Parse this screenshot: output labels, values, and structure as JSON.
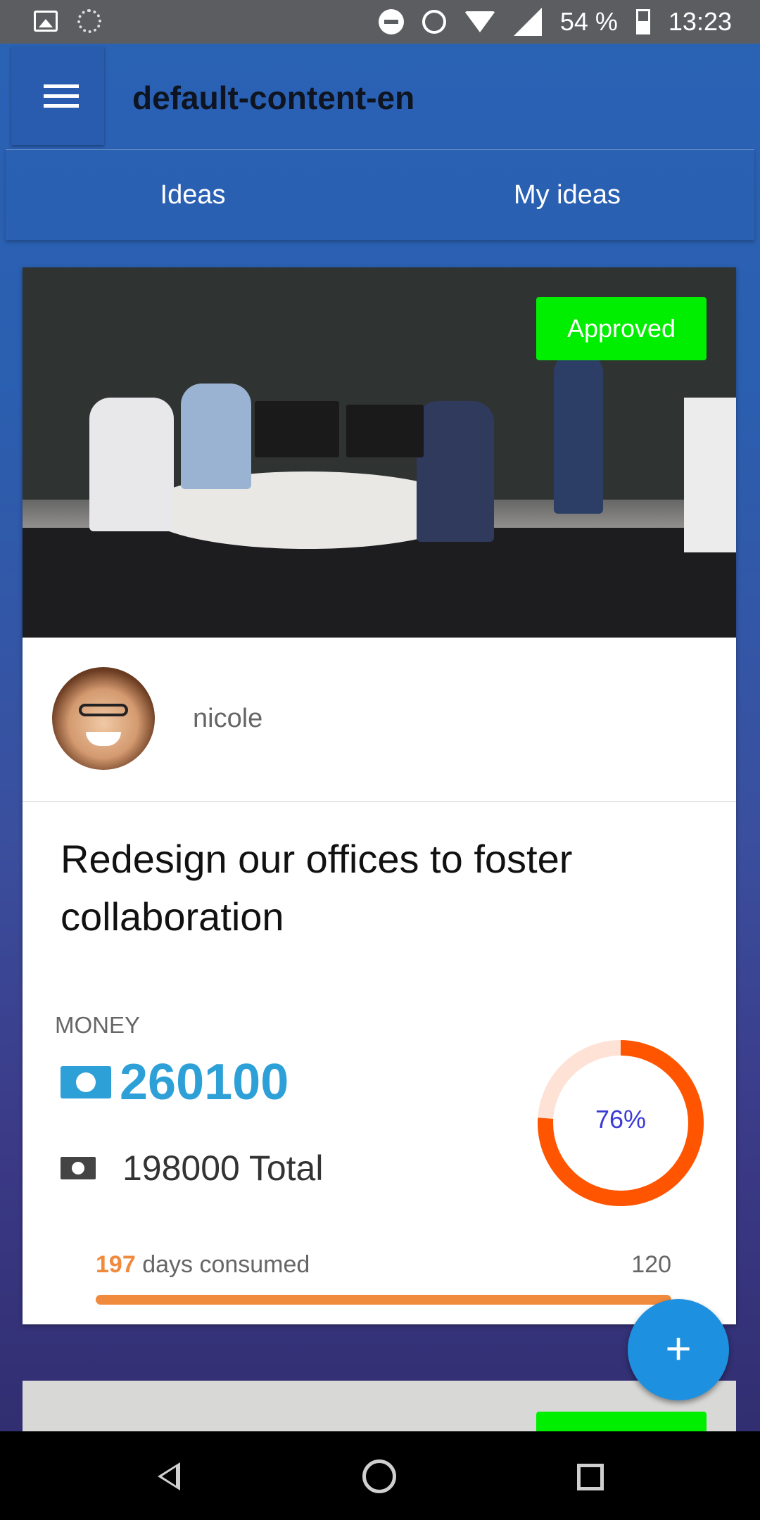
{
  "status_bar": {
    "battery": "54 %",
    "time": "13:23",
    "icons": [
      "image-icon",
      "sync-icon",
      "do-not-disturb-icon",
      "alarm-icon",
      "wifi-icon",
      "signal-icon",
      "battery-icon"
    ]
  },
  "app_bar": {
    "title": "default-content-en",
    "menu_icon": "hamburger-menu-icon"
  },
  "tabs": [
    {
      "label": "Ideas"
    },
    {
      "label": "My ideas"
    }
  ],
  "ideas": [
    {
      "status": "Approved",
      "status_color": "#00ee00",
      "author": "nicole",
      "title": "Redesign our offices to foster collaboration",
      "money_label": "MONEY",
      "money_value": "260100",
      "total_text": "198000 Total",
      "percent": 0.76,
      "percent_label": "76%",
      "days_consumed": "197",
      "days_text": "days consumed",
      "days_total": "120",
      "accent_color": "#2ea0d8",
      "donut_color": "#ff5500",
      "progress_color": "#f08a3c"
    }
  ],
  "fab": {
    "label": "+"
  },
  "nav_bar": {
    "icons": [
      "back-icon",
      "home-icon",
      "recents-icon"
    ]
  }
}
